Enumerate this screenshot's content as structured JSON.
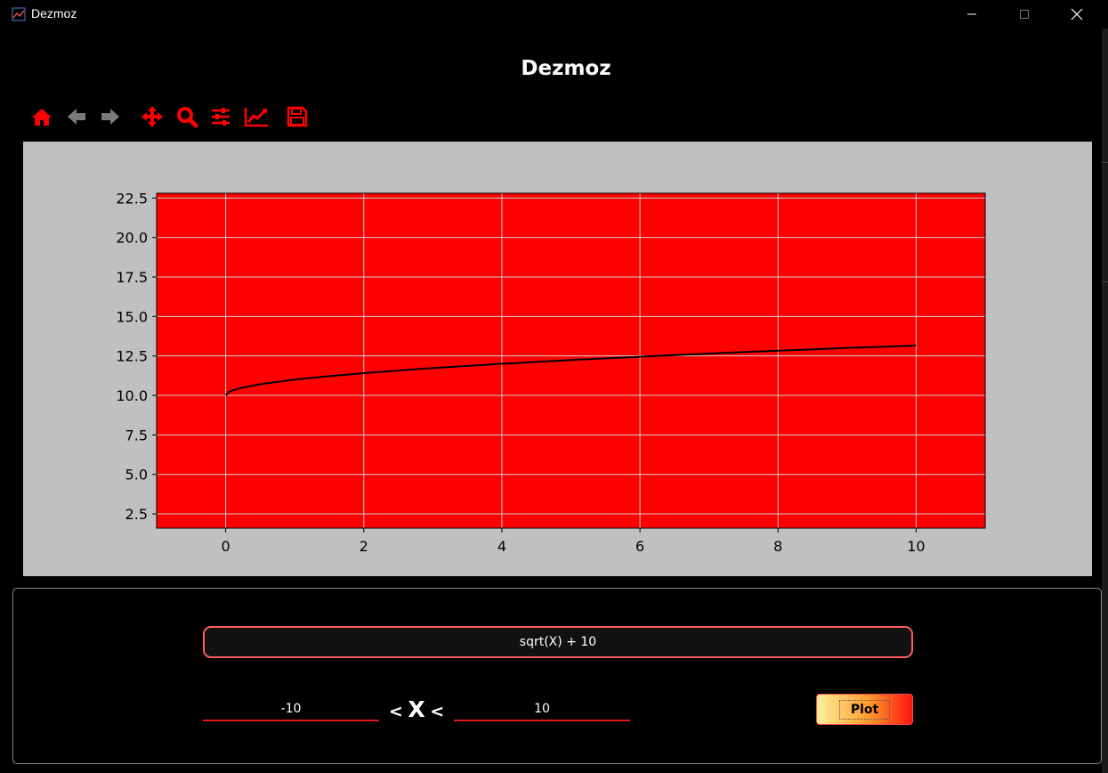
{
  "window": {
    "title": "Dezmoz"
  },
  "heading": "Dezmoz",
  "toolbar": {
    "tools": [
      {
        "icon": "home-icon",
        "enabled": true
      },
      {
        "icon": "back-arrow-icon",
        "enabled": false
      },
      {
        "icon": "forward-arrow-icon",
        "enabled": false
      },
      {
        "icon": "pan-icon",
        "enabled": true
      },
      {
        "icon": "zoom-icon",
        "enabled": true
      },
      {
        "icon": "subplots-config-icon",
        "enabled": true
      },
      {
        "icon": "axes-edit-icon",
        "enabled": true
      },
      {
        "icon": "save-icon",
        "enabled": true
      }
    ]
  },
  "colors": {
    "accent": "#ff0000",
    "figure_background": "#c0c0c0",
    "axes_background": "#ff0000",
    "grid": "#d0d0d0",
    "line": "#000000",
    "disabled_icon": "#7a7a7a"
  },
  "chart_data": {
    "type": "line",
    "title": "",
    "xlabel": "",
    "ylabel": "",
    "xlim": [
      -1,
      11
    ],
    "ylim": [
      1.6,
      22.8
    ],
    "xticks": [
      0,
      2,
      4,
      6,
      8,
      10
    ],
    "yticks": [
      2.5,
      5.0,
      7.5,
      10.0,
      12.5,
      15.0,
      17.5,
      20.0,
      22.5
    ],
    "xtick_labels": [
      "0",
      "2",
      "4",
      "6",
      "8",
      "10"
    ],
    "ytick_labels": [
      "2.5",
      "5.0",
      "7.5",
      "10.0",
      "12.5",
      "15.0",
      "17.5",
      "20.0",
      "22.5"
    ],
    "grid": true,
    "series": [
      {
        "x": [
          0,
          0.05,
          0.1,
          0.25,
          0.5,
          1,
          1.5,
          2,
          3,
          4,
          5,
          6,
          7,
          8,
          9,
          10
        ],
        "y": [
          10.0,
          10.22,
          10.32,
          10.5,
          10.71,
          11.0,
          11.22,
          11.41,
          11.73,
          12.0,
          12.24,
          12.45,
          12.65,
          12.83,
          13.0,
          13.16
        ]
      }
    ]
  },
  "controls": {
    "function_value": "sqrt(X) + 10",
    "x_min_value": "-10",
    "x_max_value": "10",
    "range_lt1": "<",
    "range_x": "X",
    "range_lt2": "<",
    "plot_label": "Plot"
  }
}
